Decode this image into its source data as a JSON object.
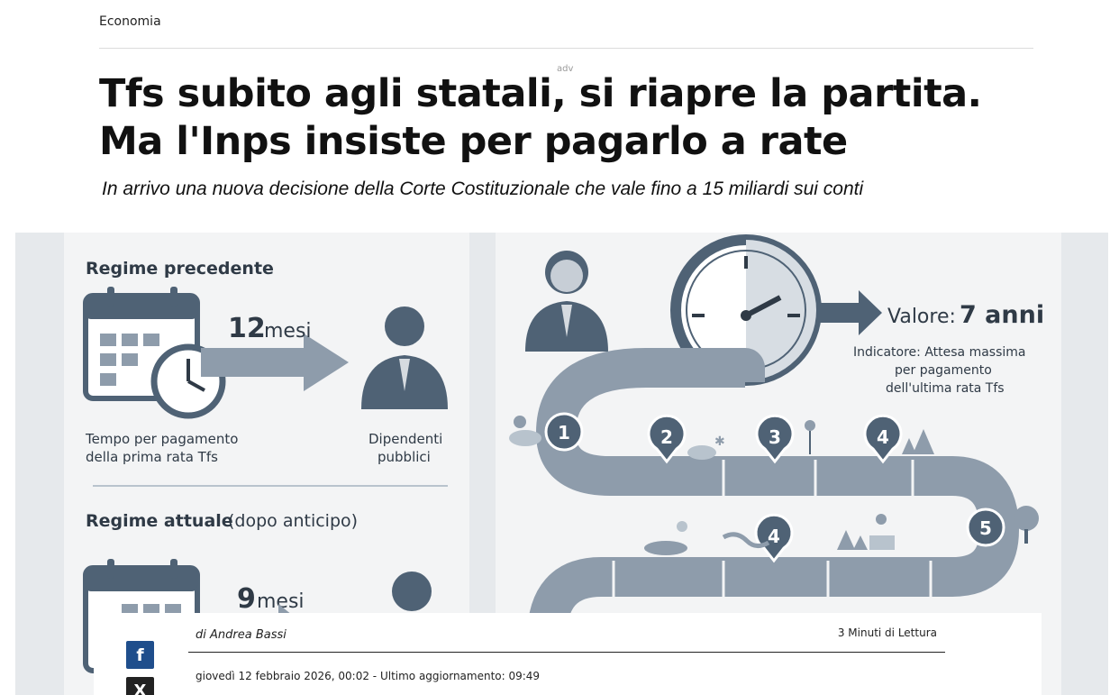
{
  "article": {
    "section": "Economia",
    "adv_label": "adv",
    "title": "Tfs subito agli statali, si riapre la partita. Ma l'Inps insiste per pagarlo a rate",
    "subtitle": "In arrivo una nuova decisione della Corte Costituzionale che vale fino a 15 miliardi sui conti",
    "author": "di Andrea Bassi",
    "read_time": "3 Minuti di Lettura",
    "date": "giovedì 12 febbraio 2026, 00:02 - Ultimo aggiornamento: 09:49"
  },
  "share": {
    "facebook_icon": "f",
    "x_icon": "X"
  },
  "infographic": {
    "left_panel": {
      "regime1_title": "Regime precedente",
      "regime1_months": "12",
      "regime1_months_unit": "mesi",
      "caption_left_1": "Tempo per pagamento",
      "caption_left_2": "della prima rata Tfs",
      "caption_right_1": "Dipendenti",
      "caption_right_2": "pubblici",
      "regime2_title": "Regime attuale",
      "regime2_note": "(dopo anticipo)",
      "regime2_months": "9",
      "regime2_months_unit": "mesi"
    },
    "right_panel": {
      "value_prefix": "Valore:",
      "value_text": "7 anni",
      "indicator_1": "Indicatore: Attesa massima",
      "indicator_2": "per pagamento",
      "indicator_3": "dell'ultima rata Tfs",
      "step_labels": [
        "1",
        "2",
        "3",
        "4",
        "5",
        "4"
      ]
    },
    "colors": {
      "primary": "#4f6275",
      "secondary": "#8e9cab",
      "light": "#b8c3cd",
      "background": "#f3f4f5"
    }
  }
}
